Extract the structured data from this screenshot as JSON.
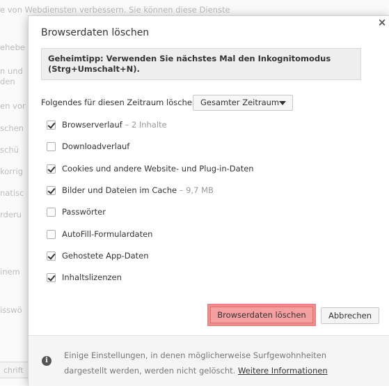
{
  "background": {
    "top_text": "e von Webdiensten verbessern. Sie können diese Dienste",
    "fragments": [
      "ehebe",
      "n und",
      "den",
      "en vor",
      "schen",
      "schü",
      "korrig",
      "natisc",
      "rderu",
      "inem",
      "isswö"
    ],
    "bottom_box": "chrift"
  },
  "dialog": {
    "title": "Browserdaten löschen",
    "close_glyph": "×",
    "tip": "Geheimtipp: Verwenden Sie nächstes Mal den Inkognitomodus (Strg+Umschalt+N).",
    "range_label": "Folgendes für diesen Zeitraum löschen:",
    "range_value": "Gesamter Zeitraum",
    "options": [
      {
        "label": "Browserverlauf",
        "extra": " – 2 Inhalte",
        "checked": true
      },
      {
        "label": "Downloadverlauf",
        "extra": "",
        "checked": false
      },
      {
        "label": "Cookies und andere Website- und Plug-in-Daten",
        "extra": "",
        "checked": true
      },
      {
        "label": "Bilder und Dateien im Cache",
        "extra": " – 9,7 MB",
        "checked": true
      },
      {
        "label": "Passwörter",
        "extra": "",
        "checked": false
      },
      {
        "label": "AutoFill-Formulardaten",
        "extra": "",
        "checked": false
      },
      {
        "label": "Gehostete App-Daten",
        "extra": "",
        "checked": true
      },
      {
        "label": "Inhaltslizenzen",
        "extra": "",
        "checked": true
      }
    ],
    "primary_button": "Browserdaten löschen",
    "cancel_button": "Abbrechen",
    "footer_text": "Einige Einstellungen, in denen möglicherweise Surfgewohnheiten dargestellt werden, werden nicht gelöscht. ",
    "footer_link": "Weitere Informationen",
    "info_glyph": "i"
  },
  "colors": {
    "highlight": "#f5a0a0",
    "highlight_border": "#e07070"
  }
}
